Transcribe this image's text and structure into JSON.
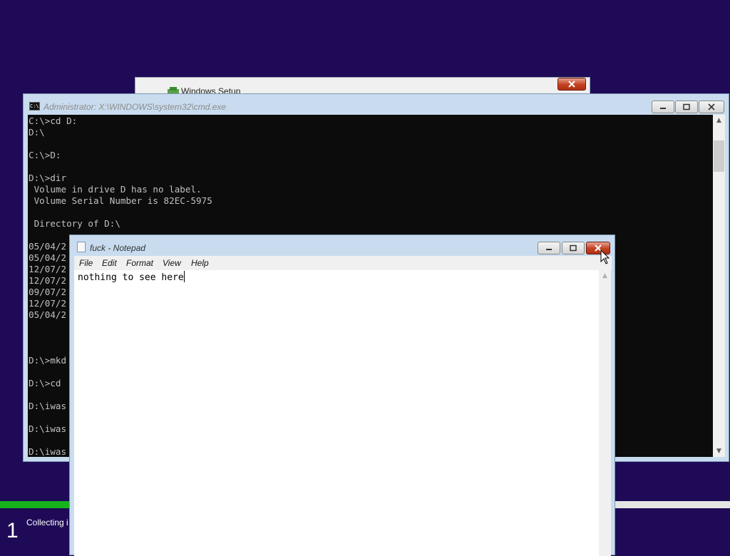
{
  "setup_window": {
    "title": "Windows Setup",
    "close_icon": "close-icon"
  },
  "cmd": {
    "title": "Administrator: X:\\WINDOWS\\system32\\cmd.exe",
    "icon": "cmd-icon",
    "lines": [
      "C:\\>cd D:",
      "D:\\",
      "",
      "C:\\>D:",
      "",
      "D:\\>dir",
      " Volume in drive D has no label.",
      " Volume Serial Number is 82EC-5975",
      "",
      " Directory of D:\\",
      "",
      "05/04/2",
      "05/04/2",
      "12/07/2",
      "12/07/2",
      "09/07/2",
      "12/07/2",
      "05/04/2",
      "",
      "",
      "",
      "D:\\>mkd",
      "",
      "D:\\>cd",
      "",
      "D:\\iwas",
      "",
      "D:\\iwas",
      "",
      "D:\\iwas"
    ],
    "scroll_up_icon": "chevron-up-icon",
    "scroll_down_icon": "chevron-down-icon"
  },
  "notepad": {
    "title": "fuck - Notepad",
    "menu": [
      "File",
      "Edit",
      "Format",
      "View",
      "Help"
    ],
    "content": "nothing to see here"
  },
  "setup_progress": {
    "step_number": "1",
    "step_text": "Collecting i",
    "progress_percent": 9.5,
    "progress_color": "#17b21c"
  },
  "colors": {
    "desktop_bg": "#1e0a56",
    "console_bg": "#0c0c0c",
    "console_fg": "#c0c0c0"
  }
}
